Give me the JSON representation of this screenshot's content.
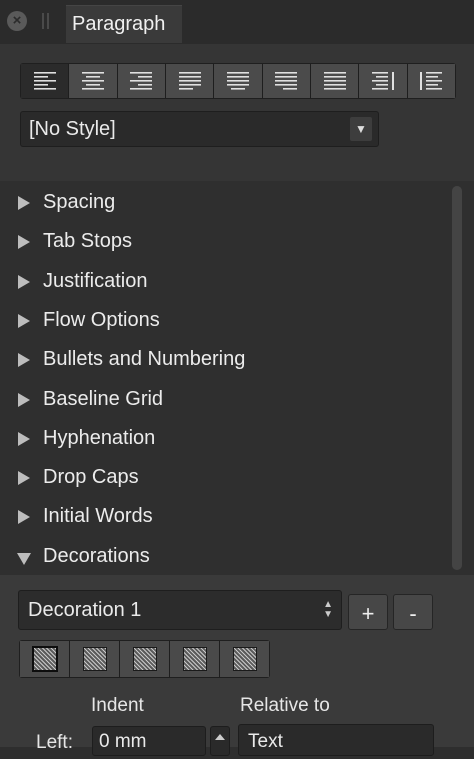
{
  "panel": {
    "tab_title": "Paragraph",
    "close_icon": "close-icon",
    "grip_icon": "grip-icon"
  },
  "alignment": {
    "buttons": [
      {
        "name": "align-left",
        "icon": "align-left-icon"
      },
      {
        "name": "align-center",
        "icon": "align-center-icon"
      },
      {
        "name": "align-right",
        "icon": "align-right-icon"
      },
      {
        "name": "justify-left",
        "icon": "justify-left-icon"
      },
      {
        "name": "justify-center",
        "icon": "justify-center-icon"
      },
      {
        "name": "justify-right",
        "icon": "justify-right-icon"
      },
      {
        "name": "justify-all",
        "icon": "justify-all-icon"
      },
      {
        "name": "align-towards-spine",
        "icon": "align-towards-spine-icon"
      },
      {
        "name": "align-away-from-spine",
        "icon": "align-away-from-spine-icon"
      }
    ],
    "active_index": 0
  },
  "style_select": {
    "value": "[No Style]",
    "arrow": "▼"
  },
  "sections": [
    {
      "label": "Spacing",
      "expanded": false
    },
    {
      "label": "Tab Stops",
      "expanded": false
    },
    {
      "label": "Justification",
      "expanded": false
    },
    {
      "label": "Flow Options",
      "expanded": false
    },
    {
      "label": "Bullets and Numbering",
      "expanded": false
    },
    {
      "label": "Baseline Grid",
      "expanded": false
    },
    {
      "label": "Hyphenation",
      "expanded": false
    },
    {
      "label": "Drop Caps",
      "expanded": false
    },
    {
      "label": "Initial Words",
      "expanded": false
    },
    {
      "label": "Decorations",
      "expanded": true
    }
  ],
  "decorations": {
    "select_value": "Decoration 1",
    "add_label": "+",
    "remove_label": "-",
    "edge_buttons": [
      "decoration-all-edges",
      "decoration-top-edge",
      "decoration-bottom-edge",
      "decoration-left-edge",
      "decoration-right-edge"
    ],
    "indent_label": "Indent",
    "relative_label": "Relative to",
    "left_label": "Left:",
    "left_value": "0 mm",
    "relative_value": "Text"
  },
  "colors": {
    "panel_bg": "#353535",
    "section_bg": "#2f2f2f",
    "button_bg": "#4b4b4b",
    "text": "#ececec"
  }
}
